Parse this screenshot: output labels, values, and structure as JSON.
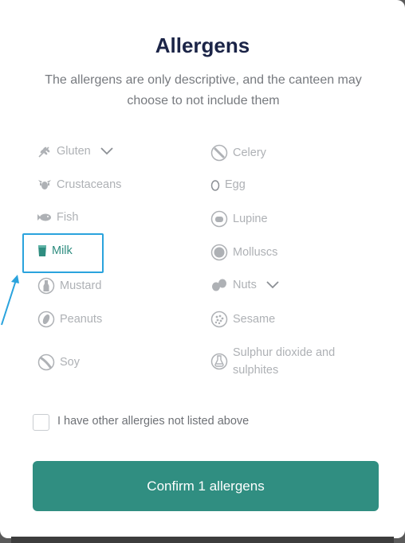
{
  "header": {
    "title": "Allergens",
    "subtitle": "The allergens are only descriptive, and the canteen may choose to not include them"
  },
  "allergens_left": [
    {
      "label": "Gluten",
      "icon": "wheat-icon",
      "expandable": true
    },
    {
      "label": "Crustaceans",
      "icon": "crustacean-icon"
    },
    {
      "label": "Fish",
      "icon": "fish-icon"
    },
    {
      "label": "Milk",
      "icon": "milk-icon",
      "selected": true
    },
    {
      "label": "Mustard",
      "icon": "mustard-icon"
    },
    {
      "label": "Peanuts",
      "icon": "peanut-icon"
    },
    {
      "label": "Soy",
      "icon": "soy-icon"
    }
  ],
  "allergens_right": [
    {
      "label": "Celery",
      "icon": "celery-icon"
    },
    {
      "label": "Egg",
      "icon": "egg-icon"
    },
    {
      "label": "Lupine",
      "icon": "lupine-icon"
    },
    {
      "label": "Molluscs",
      "icon": "mollusc-icon"
    },
    {
      "label": "Nuts",
      "icon": "nut-icon",
      "expandable": true
    },
    {
      "label": "Sesame",
      "icon": "sesame-icon"
    },
    {
      "label": "Sulphur dioxide and",
      "label_line2": "sulphites",
      "icon": "sulphite-icon"
    }
  ],
  "other_allergies": {
    "label": "I have other allergies not listed above",
    "checked": false
  },
  "confirm_button": {
    "label": "Confirm 1 allergens"
  },
  "colors": {
    "accent": "#308e81",
    "title": "#1b2447",
    "muted": "#aeb1b5",
    "highlight": "#2aa3dd"
  }
}
